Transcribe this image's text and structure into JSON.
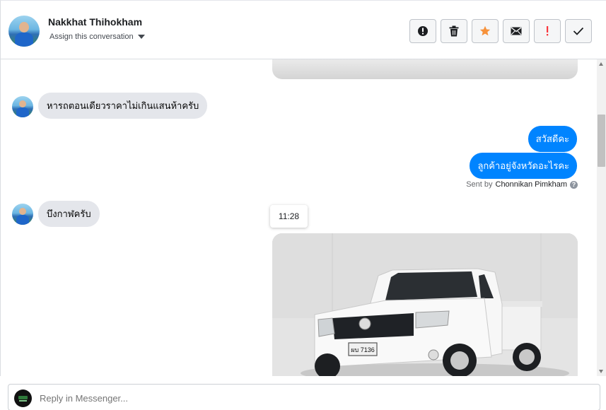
{
  "header": {
    "contact_name": "Nakkhat Thihokham",
    "assign_label": "Assign this conversation",
    "actions": [
      {
        "icon": "alert-circle-icon",
        "name": "mark-spam-button"
      },
      {
        "icon": "trash-icon",
        "name": "delete-button"
      },
      {
        "icon": "star-icon",
        "name": "star-button",
        "color": "#f7923b"
      },
      {
        "icon": "envelope-icon",
        "name": "mark-unread-button"
      },
      {
        "icon": "exclamation-icon",
        "name": "follow-up-button",
        "color": "#fa383e"
      },
      {
        "icon": "checkmark-icon",
        "name": "mark-done-button"
      }
    ]
  },
  "messages": {
    "incoming_1": "หารถตอนเดียวราคาไม่เกินแสนห้าครับ",
    "outgoing_1": "สวัสดีคะ",
    "outgoing_2": "ลูกค้าอยู่จังหวัดอะไรคะ",
    "sent_by_prefix": "Sent by",
    "sent_by_name": "Chonnikan Pimkham",
    "sent_by_help": "?",
    "incoming_2": "บึงกาฬครับ",
    "timestamp": "11:28",
    "photo_plate": "ผบ 7136"
  },
  "composer": {
    "placeholder": "Reply in Messenger..."
  },
  "colors": {
    "outgoing_bubble": "#0084ff",
    "incoming_bubble": "#e4e6eb",
    "star": "#f7923b",
    "follow_up": "#fa383e"
  }
}
